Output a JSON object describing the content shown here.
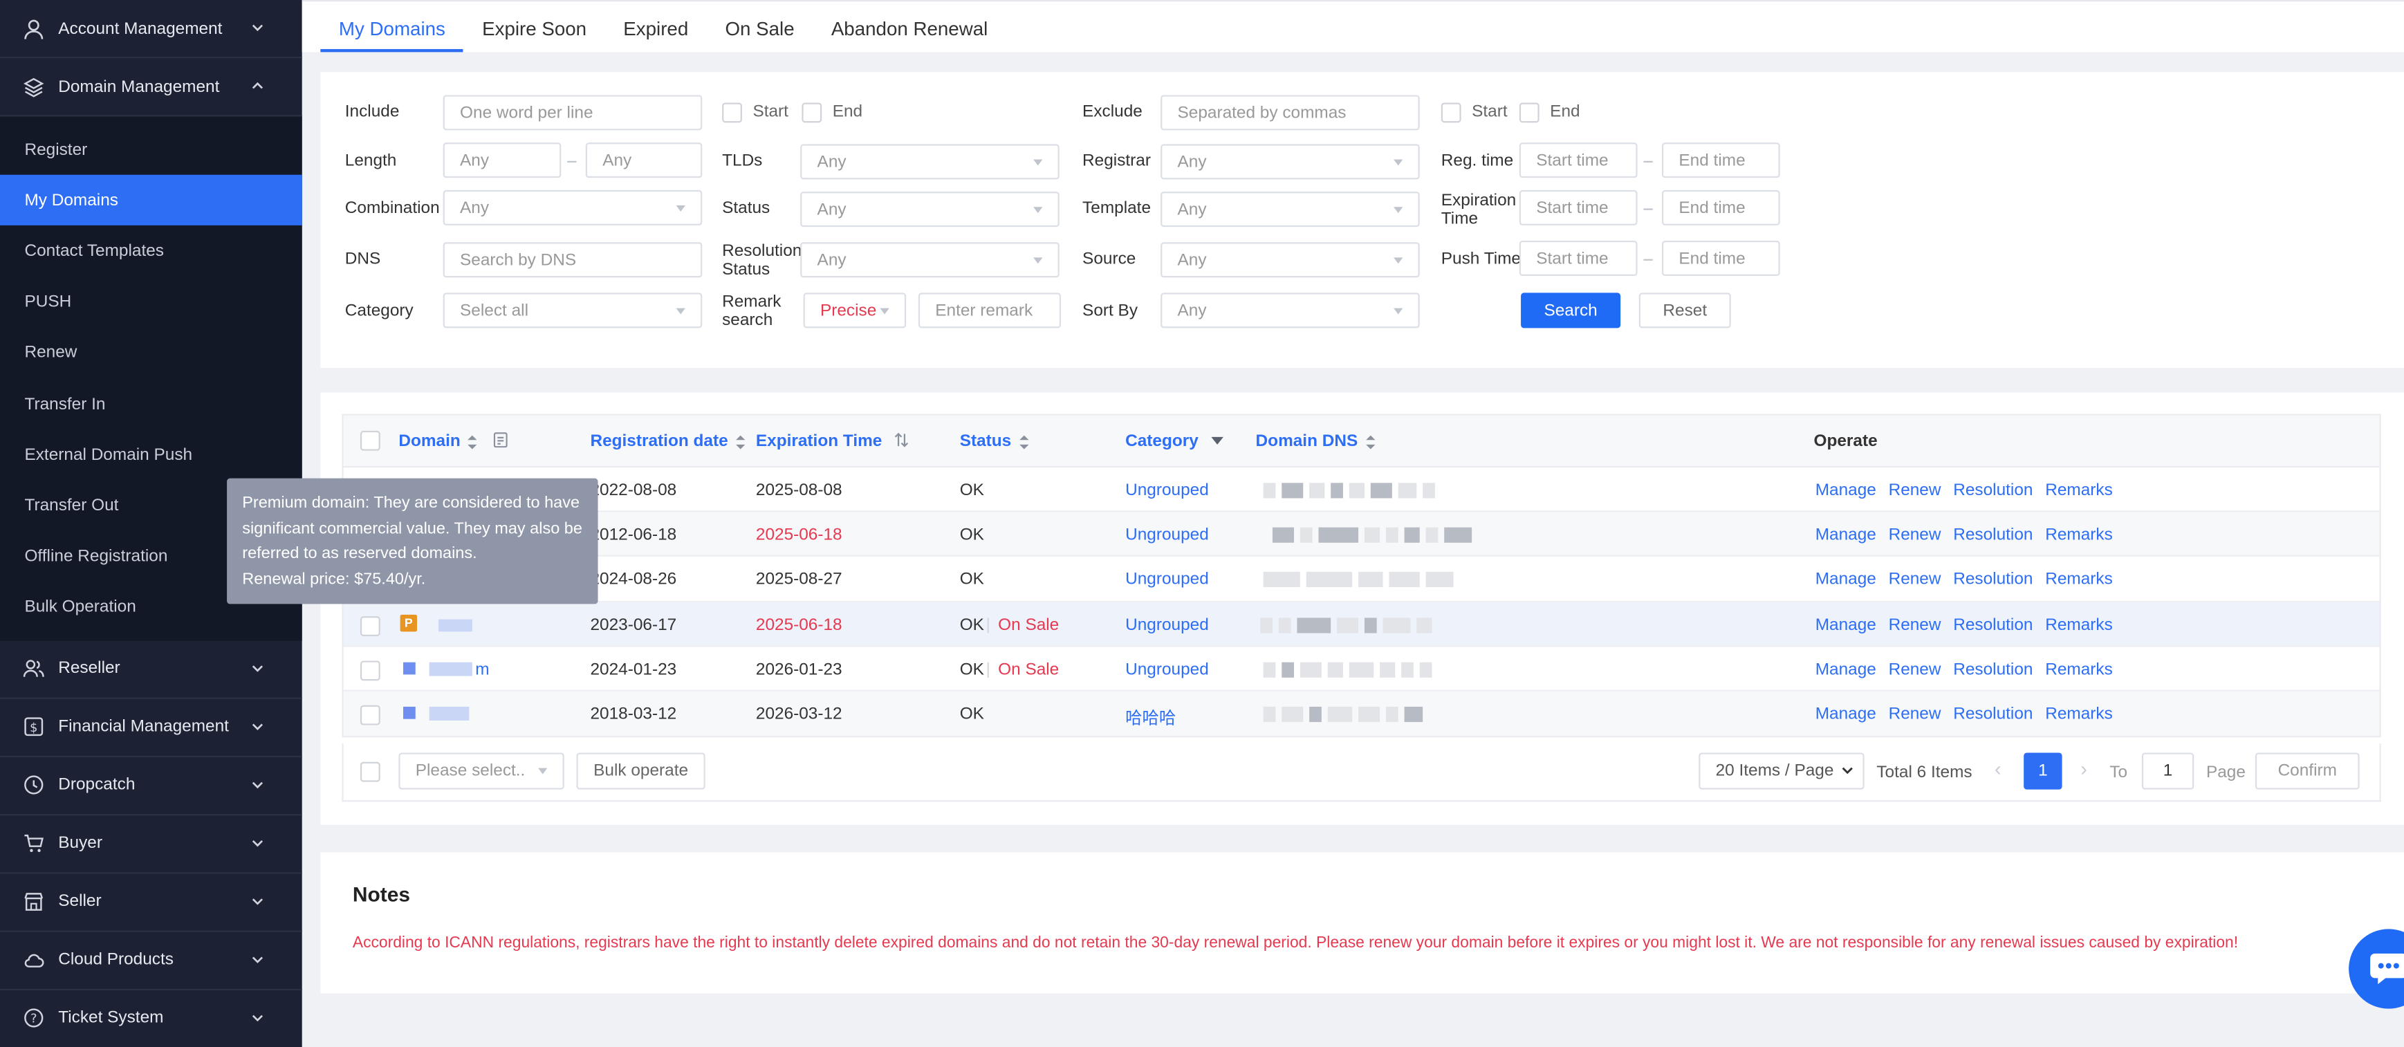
{
  "sidebar": {
    "groups_top": [
      {
        "label": "Account Management",
        "icon": "user-icon"
      },
      {
        "label": "Domain Management",
        "icon": "layers-icon"
      }
    ],
    "items": [
      "Register",
      "My Domains",
      "Contact Templates",
      "PUSH",
      "Renew",
      "Transfer In",
      "External Domain Push",
      "Transfer Out",
      "Offline Registration",
      "Bulk Operation"
    ],
    "active_item": "My Domains",
    "groups_bottom": [
      {
        "label": "Reseller",
        "icon": "people-icon"
      },
      {
        "label": "Financial Management",
        "icon": "money-icon"
      },
      {
        "label": "Dropcatch",
        "icon": "clock-icon"
      },
      {
        "label": "Buyer",
        "icon": "cart-icon"
      },
      {
        "label": "Seller",
        "icon": "shop-icon"
      },
      {
        "label": "Cloud Products",
        "icon": "cloud-icon"
      },
      {
        "label": "Ticket System",
        "icon": "help-icon"
      }
    ]
  },
  "tabs": [
    "My Domains",
    "Expire Soon",
    "Expired",
    "On Sale",
    "Abandon Renewal"
  ],
  "filters": {
    "include_label": "Include",
    "include_placeholder": "One word per line",
    "start_label": "Start",
    "end_label": "End",
    "exclude_label": "Exclude",
    "exclude_placeholder": "Separated by commas",
    "length_label": "Length",
    "any": "Any",
    "tlds_label": "TLDs",
    "registrar_label": "Registrar",
    "reg_time_label": "Reg. time",
    "start_time": "Start time",
    "end_time": "End time",
    "combination_label": "Combination",
    "status_label": "Status",
    "template_label": "Template",
    "expiration_time_label": "Expiration Time",
    "dns_label": "DNS",
    "dns_placeholder": "Search by DNS",
    "resolution_status_label": "Resolution Status",
    "source_label": "Source",
    "push_time_label": "Push Time",
    "category_label": "Category",
    "category_value": "Select all",
    "remark_search_label": "Remark search",
    "remark_mode": "Precise",
    "remark_placeholder": "Enter remark",
    "sort_by_label": "Sort By",
    "search_button": "Search",
    "reset_button": "Reset"
  },
  "table": {
    "columns": [
      "Domain",
      "Registration date",
      "Expiration Time",
      "Status",
      "Category",
      "Domain DNS",
      "Operate"
    ],
    "rows": [
      {
        "reg": "2022-08-08",
        "exp": "2025-08-08",
        "exp_red": false,
        "status": "OK",
        "sale": "",
        "category": "Ungrouped",
        "remarks_highlight": true
      },
      {
        "reg": "2012-06-18",
        "exp": "2025-06-18",
        "exp_red": true,
        "status": "OK",
        "sale": "",
        "category": "Ungrouped",
        "remarks_highlight": false
      },
      {
        "reg": "2024-08-26",
        "exp": "2025-08-27",
        "exp_red": false,
        "status": "OK",
        "sale": "",
        "category": "Ungrouped",
        "remarks_highlight": false
      },
      {
        "reg": "2023-06-17",
        "exp": "2025-06-18",
        "exp_red": true,
        "status": "OK",
        "sale": "On Sale",
        "category": "Ungrouped",
        "remarks_highlight": false,
        "premium_badge": "P"
      },
      {
        "reg": "2024-01-23",
        "exp": "2026-01-23",
        "exp_red": false,
        "status": "OK",
        "sale": "On Sale",
        "category": "Ungrouped",
        "remarks_highlight": false,
        "domain_suffix": "m"
      },
      {
        "reg": "2018-03-12",
        "exp": "2026-03-12",
        "exp_red": false,
        "status": "OK",
        "sale": "",
        "category": "哈哈哈",
        "remarks_highlight": false
      }
    ],
    "operations": [
      "Manage",
      "Renew",
      "Resolution",
      "Remarks"
    ],
    "bulk_select_placeholder": "Please select..",
    "bulk_button": "Bulk operate",
    "page_size": "20 Items / Page",
    "total": "Total 6 Items",
    "current_page": "1",
    "to_label": "To",
    "page_input": "1",
    "page_label": "Page",
    "confirm_button": "Confirm"
  },
  "tooltip": {
    "line1": "Premium domain: They are considered to have",
    "line2": "significant commercial value. They may also be",
    "line3": "referred to as reserved domains.",
    "line4": "Renewal price: $75.40/yr."
  },
  "notes": {
    "title": "Notes",
    "text": "According to ICANN regulations, registrars have the right to instantly delete expired domains and do not retain the 30-day renewal period. Please renew your domain before it expires or you might lost it. We are not responsible for any renewal issues caused by expiration!"
  },
  "colors": {
    "accent": "#2d6ef5",
    "sidebar_bg": "#1c2233",
    "warning": "#e53950"
  }
}
